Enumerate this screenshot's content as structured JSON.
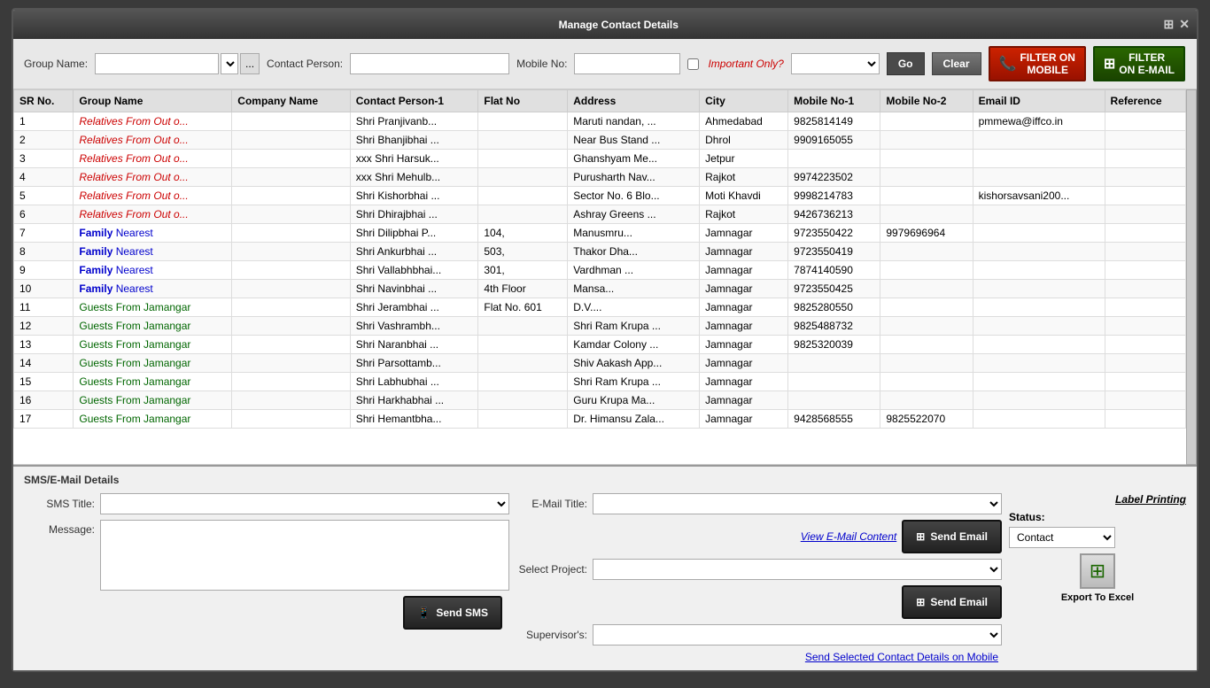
{
  "title": "Manage Contact Details",
  "toolbar": {
    "group_name_label": "Group Name:",
    "contact_person_label": "Contact Person:",
    "mobile_no_label": "Mobile No:",
    "important_only_label": "Important Only?",
    "go_label": "Go",
    "clear_label": "Clear",
    "filter_mobile_label": "FILTER ON\nMOBILE",
    "filter_email_label": "FILTER\nON E-MAIL"
  },
  "table": {
    "columns": [
      "SR No.",
      "Group Name",
      "Company Name",
      "Contact Person-1",
      "Flat No",
      "Address",
      "City",
      "Mobile No-1",
      "Mobile No-2",
      "Email ID",
      "Reference"
    ],
    "rows": [
      {
        "sr": "1",
        "group": "Relatives From Out o...",
        "company": "",
        "contact": "Shri Pranjivanb...",
        "flat": "",
        "address": "Maruti nandan, ...",
        "city": "Ahmedabad",
        "mobile1": "9825814149",
        "mobile2": "",
        "email": "pmmewa@iffco.in",
        "reference": "",
        "group_type": "relatives"
      },
      {
        "sr": "2",
        "group": "Relatives From Out o...",
        "company": "",
        "contact": "Shri Bhanjibhai ...",
        "flat": "",
        "address": "Near Bus Stand ...",
        "city": "Dhrol",
        "mobile1": "9909165055",
        "mobile2": "",
        "email": "",
        "reference": "",
        "group_type": "relatives"
      },
      {
        "sr": "3",
        "group": "Relatives From Out o...",
        "company": "",
        "contact": "xxx Shri Harsuk...",
        "flat": "",
        "address": "Ghanshyam Me...",
        "city": "Jetpur",
        "mobile1": "",
        "mobile2": "",
        "email": "",
        "reference": "",
        "group_type": "relatives"
      },
      {
        "sr": "4",
        "group": "Relatives From Out o...",
        "company": "",
        "contact": "xxx Shri Mehulb...",
        "flat": "",
        "address": "Purusharth  Nav...",
        "city": "Rajkot",
        "mobile1": "9974223502",
        "mobile2": "",
        "email": "",
        "reference": "",
        "group_type": "relatives"
      },
      {
        "sr": "5",
        "group": "Relatives From Out o...",
        "company": "",
        "contact": "Shri Kishorbhai ...",
        "flat": "",
        "address": "Sector No. 6 Blo...",
        "city": "Moti Khavdi",
        "mobile1": "9998214783",
        "mobile2": "",
        "email": "kishorsavsani200...",
        "reference": "",
        "group_type": "relatives"
      },
      {
        "sr": "6",
        "group": "Relatives From Out o...",
        "company": "",
        "contact": "Shri Dhirajbhai ...",
        "flat": "",
        "address": "Ashray Greens ...",
        "city": "Rajkot",
        "mobile1": "9426736213",
        "mobile2": "",
        "email": "",
        "reference": "",
        "group_type": "relatives"
      },
      {
        "sr": "7",
        "group": "Family Nearest",
        "company": "",
        "contact": "Shri Dilipbhai P...",
        "flat": "104,",
        "address": "Manusmru...",
        "city": "Jamnagar",
        "mobile1": "9723550422",
        "mobile2": "9979696964",
        "email": "",
        "reference": "",
        "group_type": "family"
      },
      {
        "sr": "8",
        "group": "Family Nearest",
        "company": "",
        "contact": "Shri Ankurbhai ...",
        "flat": "503,",
        "address": "Thakor Dha...",
        "city": "Jamnagar",
        "mobile1": "9723550419",
        "mobile2": "",
        "email": "",
        "reference": "",
        "group_type": "family"
      },
      {
        "sr": "9",
        "group": "Family Nearest",
        "company": "",
        "contact": "Shri Vallabhbhai...",
        "flat": "301,",
        "address": "Vardhman ...",
        "city": "Jamnagar",
        "mobile1": "7874140590",
        "mobile2": "",
        "email": "",
        "reference": "",
        "group_type": "family"
      },
      {
        "sr": "10",
        "group": "Family Nearest",
        "company": "",
        "contact": "Shri Navinbhai ...",
        "flat": "4th Floor",
        "address": "Mansa...",
        "city": "Jamnagar",
        "mobile1": "9723550425",
        "mobile2": "",
        "email": "",
        "reference": "",
        "group_type": "family"
      },
      {
        "sr": "11",
        "group": "Guests From Jamangar",
        "company": "",
        "contact": "Shri Jerambhai ...",
        "flat": "Flat No. 601",
        "address": "D.V....",
        "city": "Jamnagar",
        "mobile1": "9825280550",
        "mobile2": "",
        "email": "",
        "reference": "",
        "group_type": "guests"
      },
      {
        "sr": "12",
        "group": "Guests From Jamangar",
        "company": "",
        "contact": "Shri Vashrambh...",
        "flat": "",
        "address": "Shri Ram Krupa ...",
        "city": "Jamnagar",
        "mobile1": "9825488732",
        "mobile2": "",
        "email": "",
        "reference": "",
        "group_type": "guests"
      },
      {
        "sr": "13",
        "group": "Guests From Jamangar",
        "company": "",
        "contact": "Shri Naranbhai ...",
        "flat": "",
        "address": "Kamdar Colony ...",
        "city": "Jamnagar",
        "mobile1": "9825320039",
        "mobile2": "",
        "email": "",
        "reference": "",
        "group_type": "guests"
      },
      {
        "sr": "14",
        "group": "Guests From Jamangar",
        "company": "",
        "contact": "Shri Parsottamb...",
        "flat": "",
        "address": "Shiv Aakash App...",
        "city": "Jamnagar",
        "mobile1": "",
        "mobile2": "",
        "email": "",
        "reference": "",
        "group_type": "guests"
      },
      {
        "sr": "15",
        "group": "Guests From Jamangar",
        "company": "",
        "contact": "Shri Labhubhai ...",
        "flat": "",
        "address": "Shri Ram Krupa ...",
        "city": "Jamnagar",
        "mobile1": "",
        "mobile2": "",
        "email": "",
        "reference": "",
        "group_type": "guests"
      },
      {
        "sr": "16",
        "group": "Guests From Jamangar",
        "company": "",
        "contact": "Shri Harkhabhai ...",
        "flat": "",
        "address": "Guru Krupa  Ma...",
        "city": "Jamnagar",
        "mobile1": "",
        "mobile2": "",
        "email": "",
        "reference": "",
        "group_type": "guests"
      },
      {
        "sr": "17",
        "group": "Guests From Jamangar",
        "company": "",
        "contact": "Shri Hemantbha...",
        "flat": "",
        "address": "Dr. Himansu Zala...",
        "city": "Jamnagar",
        "mobile1": "9428568555",
        "mobile2": "9825522070",
        "email": "",
        "reference": "",
        "group_type": "guests"
      }
    ]
  },
  "bottom": {
    "panel_title": "SMS/E-Mail Details",
    "sms_title_label": "SMS Title:",
    "message_label": "Message:",
    "send_sms_label": "Send SMS",
    "email_title_label": "E-Mail Title:",
    "view_email_content": "View E-Mail Content",
    "send_email_label": "Send Email",
    "send_email_label2": "Send Email",
    "select_project_label": "Select Project:",
    "supervisor_label": "Supervisor's:",
    "label_printing": "Label Printing",
    "status_label": "Status:",
    "status_value": "Contact",
    "export_label": "Export To Excel",
    "send_selected_link": "Send Selected Contact Details on Mobile"
  }
}
